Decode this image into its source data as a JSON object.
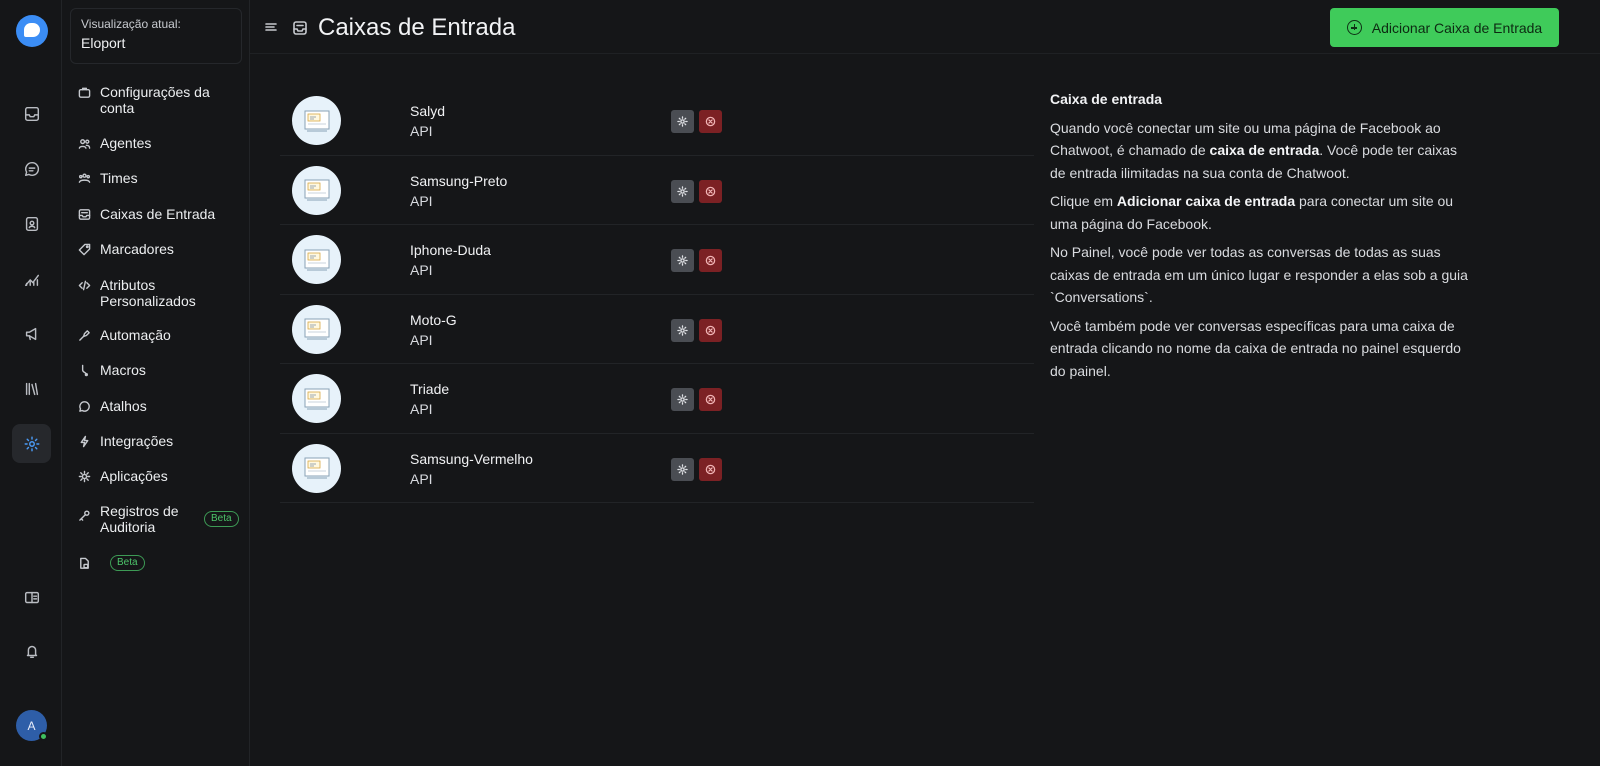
{
  "account": {
    "label": "Visualização atual:",
    "name": "Eloport"
  },
  "rail": {
    "avatar_initial": "A"
  },
  "sidebar": {
    "items": [
      {
        "label": "Configurações da conta",
        "icon": "briefcase-icon"
      },
      {
        "label": "Agentes",
        "icon": "people-icon"
      },
      {
        "label": "Times",
        "icon": "team-icon"
      },
      {
        "label": "Caixas de Entrada",
        "icon": "inbox-icon"
      },
      {
        "label": "Marcadores",
        "icon": "tag-icon"
      },
      {
        "label": "Atributos Personalizados",
        "icon": "code-icon"
      },
      {
        "label": "Automação",
        "icon": "automation-icon"
      },
      {
        "label": "Macros",
        "icon": "macro-icon"
      },
      {
        "label": "Atalhos",
        "icon": "chat-shortcut-icon"
      },
      {
        "label": "Integrações",
        "icon": "lightning-icon"
      },
      {
        "label": "Aplicações",
        "icon": "apps-icon"
      },
      {
        "label": "Registros de Auditoria",
        "icon": "key-icon",
        "badge": "Beta"
      },
      {
        "label": "",
        "icon": "document-lock-icon",
        "badge": "Beta"
      }
    ]
  },
  "header": {
    "title": "Caixas de Entrada",
    "add_label": "Adicionar Caixa de Entrada"
  },
  "inboxes": [
    {
      "name": "Salyd",
      "type": "API"
    },
    {
      "name": "Samsung-Preto",
      "type": "API"
    },
    {
      "name": "Iphone-Duda",
      "type": "API"
    },
    {
      "name": "Moto-G",
      "type": "API"
    },
    {
      "name": "Triade",
      "type": "API"
    },
    {
      "name": "Samsung-Vermelho",
      "type": "API"
    }
  ],
  "help": {
    "title": "Caixa de entrada",
    "p1_a": "Quando você conectar um site ou uma página de Facebook ao Chatwoot, é chamado de ",
    "p1_b": "caixa de entrada",
    "p1_c": ". Você pode ter caixas de entrada ilimitadas na sua conta de Chatwoot.",
    "p2_a": "Clique em ",
    "p2_b": "Adicionar caixa de entrada",
    "p2_c": " para conectar um site ou uma página do Facebook.",
    "p3": "No Painel, você pode ver todas as conversas de todas as suas caixas de entrada em um único lugar e responder a elas sob a guia `Conversations`.",
    "p4": "Você também pode ver conversas específicas para uma caixa de entrada clicando no nome da caixa de entrada no painel esquerdo do painel."
  },
  "colors": {
    "accent_green": "#3fcb5a",
    "delete_red": "#7c2124",
    "brand_blue": "#3b8df5"
  }
}
